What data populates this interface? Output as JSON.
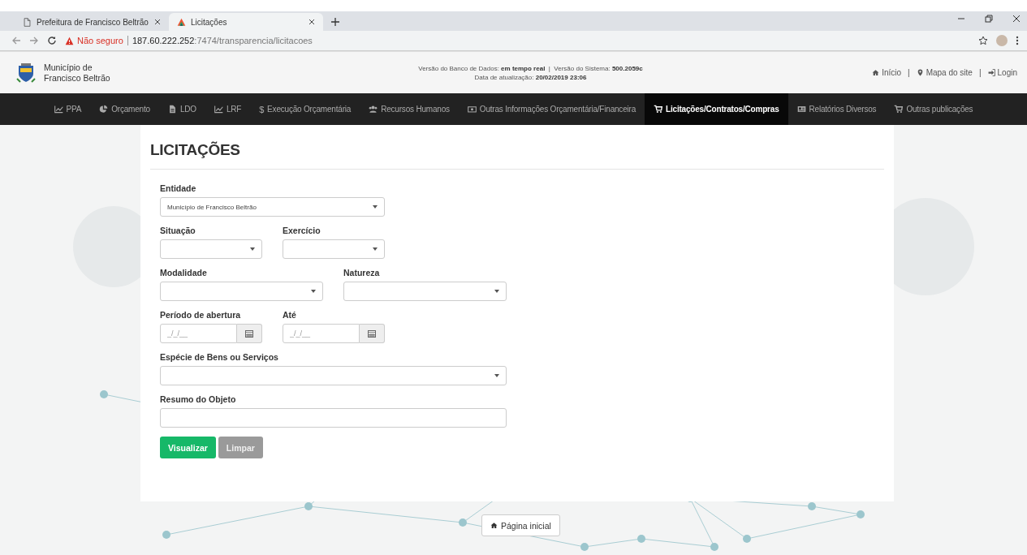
{
  "browser": {
    "tabs": [
      {
        "title": "Prefeitura de Francisco Beltrão",
        "selected": false
      },
      {
        "title": "Licitações",
        "selected": true
      }
    ],
    "address": {
      "security": "Não seguro",
      "host": "187.60.222.252",
      "path": ":7474/transparencia/licitacoes"
    }
  },
  "header": {
    "name_lines": [
      "Município de",
      "Francisco Beltrão"
    ],
    "info_lines": [
      "Versão do Banco de Dados: **em tempo real**  |  Versão do Sistema: **500.2059c**",
      "Data de atualização: **20/02/2019 23:06**"
    ],
    "links": [
      {
        "label": "Início"
      },
      {
        "label": "Mapa do site"
      },
      {
        "label": "Login"
      }
    ],
    "separator": "|"
  },
  "nav": [
    {
      "label": "PPA",
      "selected": false
    },
    {
      "label": "Orçamento",
      "selected": false
    },
    {
      "label": "LDO",
      "selected": false
    },
    {
      "label": "LRF",
      "selected": false
    },
    {
      "glyph": "$",
      "label": "Execução Orçamentária",
      "selected": false
    },
    {
      "label": "Recursos Humanos",
      "selected": false
    },
    {
      "label": "Outras Informações Orçamentária/Financeira",
      "selected": false
    },
    {
      "label": "Licitações/Contratos/Compras",
      "selected": true
    },
    {
      "label": "Relatórios Diversos",
      "selected": false
    },
    {
      "label": "Outras publicações",
      "selected": false
    }
  ],
  "form": {
    "title": "LICITAÇÕES",
    "rows": [
      [
        {
          "kind": "select",
          "label": "Entidade",
          "value": "Município de Francisco Beltrão"
        }
      ],
      [
        {
          "kind": "select",
          "label": "Situação"
        },
        {
          "kind": "select",
          "label": "Exercício"
        }
      ],
      [
        {
          "kind": "select",
          "label": "Modalidade"
        },
        {
          "kind": "select",
          "label": "Natureza"
        }
      ],
      [
        {
          "kind": "date",
          "label": "Período de abertura",
          "placeholder": "_/_/__"
        },
        {
          "kind": "date",
          "label": "Até",
          "placeholder": "_/_/__"
        }
      ],
      [
        {
          "kind": "select",
          "label": "Espécie de Bens ou Serviços"
        }
      ],
      [
        {
          "kind": "text",
          "label": "Resumo do Objeto"
        }
      ]
    ],
    "buttons": [
      {
        "kind": "primary",
        "label": "Visualizar"
      },
      {
        "kind": "secondary",
        "label": "Limpar"
      }
    ]
  },
  "footer_button": {
    "label": "Página inicial"
  }
}
